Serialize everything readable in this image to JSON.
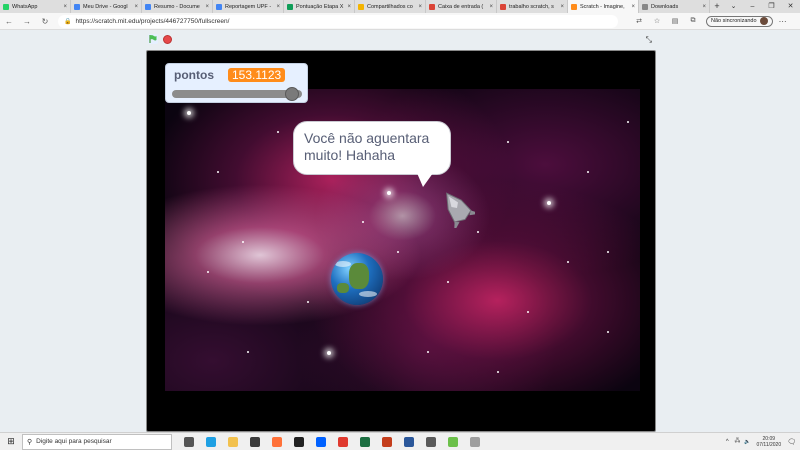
{
  "browser": {
    "tabs": [
      {
        "title": "WhatsApp",
        "color": "#25d366"
      },
      {
        "title": "Meu Drive - Googl",
        "color": "#4285f4"
      },
      {
        "title": "Resumo - Docume",
        "color": "#4285f4"
      },
      {
        "title": "Reportagem UPF -",
        "color": "#4285f4"
      },
      {
        "title": "Pontuação Etapa X",
        "color": "#0f9d58"
      },
      {
        "title": "Compartilhados co",
        "color": "#f4b400"
      },
      {
        "title": "Caixa de entrada (",
        "color": "#db4437"
      },
      {
        "title": "trabalho scratch, s",
        "color": "#db4437"
      },
      {
        "title": "Scratch - Imagine,",
        "color": "#ff8c1a",
        "active": true
      },
      {
        "title": "Downloads",
        "color": "#888888"
      }
    ],
    "new_tab_label": "+",
    "url": "https://scratch.mit.edu/projects/446727750/fullscreen/",
    "sync_label": "Não sincronizando"
  },
  "scratch": {
    "monitor": {
      "name": "pontos",
      "value": "153.1123",
      "slider_fraction": 0.97
    },
    "speech": "Você não aguentara muito! Hahaha"
  },
  "taskbar": {
    "search_placeholder": "Digite aqui para pesquisar",
    "time": "20:09",
    "date": "07/11/2020",
    "apps": [
      {
        "name": "task-view",
        "color": "#555555"
      },
      {
        "name": "edge",
        "color": "#1fa0e3"
      },
      {
        "name": "explorer",
        "color": "#f2c14e"
      },
      {
        "name": "store",
        "color": "#3c3c3c"
      },
      {
        "name": "firefox",
        "color": "#ff7139"
      },
      {
        "name": "app-dark",
        "color": "#222222"
      },
      {
        "name": "dropbox",
        "color": "#0061ff"
      },
      {
        "name": "red-app",
        "color": "#e03a2f"
      },
      {
        "name": "excel",
        "color": "#1d6f42"
      },
      {
        "name": "powerpoint",
        "color": "#c43e1c"
      },
      {
        "name": "word",
        "color": "#2b579a"
      },
      {
        "name": "photos",
        "color": "#5a5a5a"
      },
      {
        "name": "green-app",
        "color": "#6cc04a"
      },
      {
        "name": "app-gray",
        "color": "#9e9e9e"
      }
    ]
  }
}
